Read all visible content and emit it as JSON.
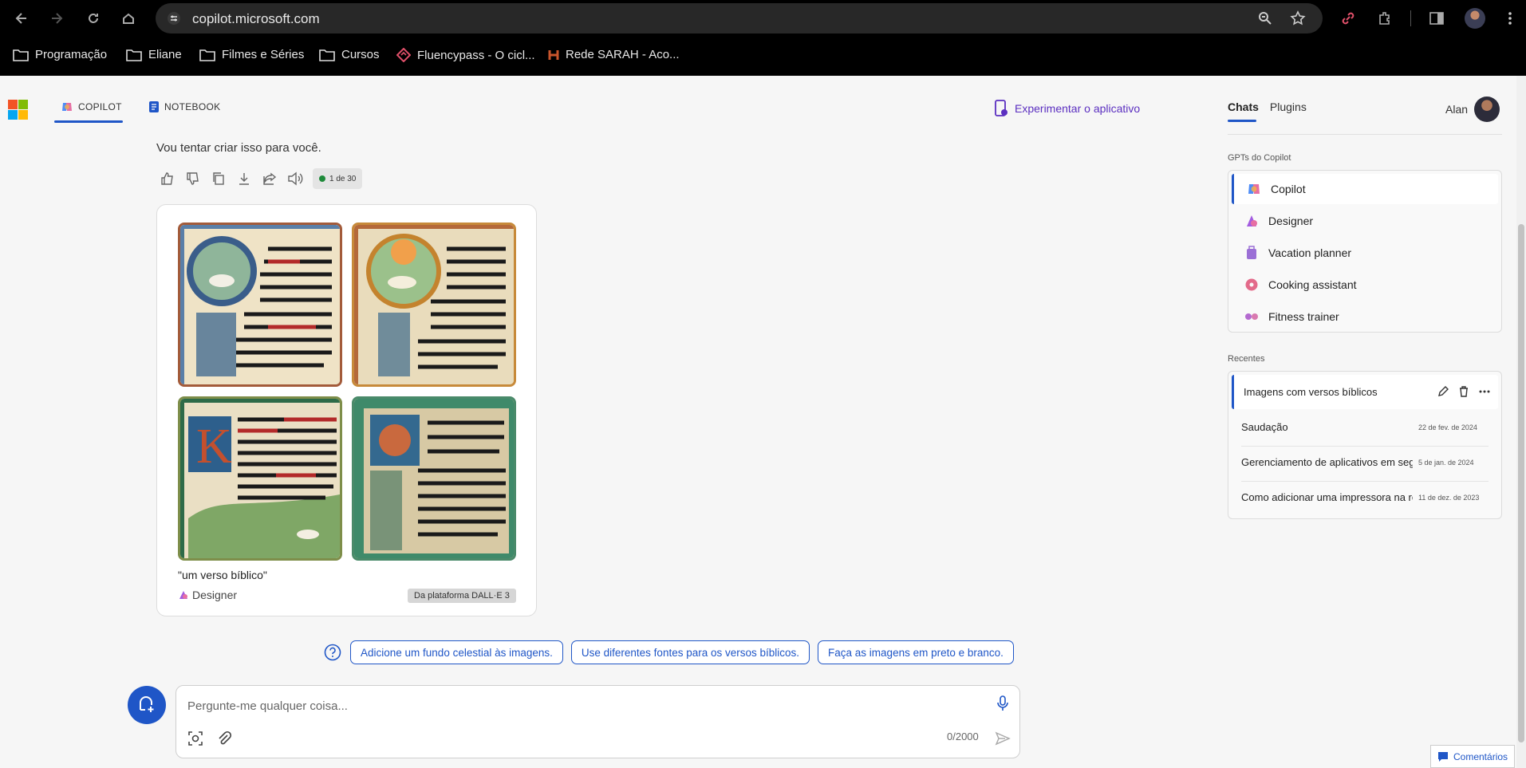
{
  "browser": {
    "url": "copilot.microsoft.com",
    "bookmarks": [
      {
        "label": "Programação"
      },
      {
        "label": "Eliane"
      },
      {
        "label": "Filmes e Séries"
      },
      {
        "label": "Cursos"
      },
      {
        "label": "Fluencypass - O cicl..."
      },
      {
        "label": "Rede SARAH - Aco..."
      }
    ]
  },
  "header": {
    "tabs": [
      {
        "label": "COPILOT"
      },
      {
        "label": "NOTEBOOK"
      }
    ],
    "try_app": "Experimentar o aplicativo"
  },
  "conversation": {
    "assistant_text": "Vou tentar criar isso para você.",
    "counter": "1 de 30",
    "image_card": {
      "images": [
        {
          "text": "The Lord is my Shepherd; I not shall want. He makes me lie down in green pastures. He leads me beside still waters."
        },
        {
          "text": "The LORD is my shepherd; I shall not want. He makes me lie down in green pastures, he leads me beside still waters."
        },
        {
          "text": "The Lord is my shepherd; I shall not want. He makes me lie down in green pastures; He leads me beside still waters."
        },
        {
          "text": "The Lord is my shepherd; I shall not want. He makes me lie down in green pastures; he leads me beside still waters."
        }
      ],
      "prompt": "\"um verso bíblico\"",
      "source": "Designer",
      "badge": "Da plataforma DALL·E 3"
    },
    "suggestions": [
      {
        "label": "Adicione um fundo celestial às imagens."
      },
      {
        "label": "Use diferentes fontes para os versos bíblicos."
      },
      {
        "label": "Faça as imagens em preto e branco."
      }
    ]
  },
  "composer": {
    "placeholder": "Pergunte-me qualquer coisa...",
    "char_count": "0/2000"
  },
  "sidebar": {
    "tabs": [
      {
        "label": "Chats"
      },
      {
        "label": "Plugins"
      }
    ],
    "user": "Alan",
    "gpts_title": "GPTs do Copilot",
    "gpts": [
      {
        "label": "Copilot",
        "icon": "copilot-icon",
        "color": "#4f8df7"
      },
      {
        "label": "Designer",
        "icon": "designer-icon",
        "color": "#a35ce0"
      },
      {
        "label": "Vacation planner",
        "icon": "suitcase-icon",
        "color": "#9b6fd6"
      },
      {
        "label": "Cooking assistant",
        "icon": "donut-icon",
        "color": "#e36a8a"
      },
      {
        "label": "Fitness trainer",
        "icon": "dumbbell-icon",
        "color": "#b46ad0"
      }
    ],
    "recent_title": "Recentes",
    "recent": [
      {
        "title": "Imagens com versos bíblicos",
        "date": ""
      },
      {
        "title": "Saudação",
        "date": "22 de fev. de 2024"
      },
      {
        "title": "Gerenciamento de aplicativos em segundo plano",
        "date": "5 de jan. de 2024"
      },
      {
        "title": "Como adicionar uma impressora na rede",
        "date": "11 de dez. de 2023"
      }
    ],
    "feedback": "Comentários"
  },
  "colors": {
    "accent": "#1f56c7",
    "try_app": "#5b2fc0"
  }
}
